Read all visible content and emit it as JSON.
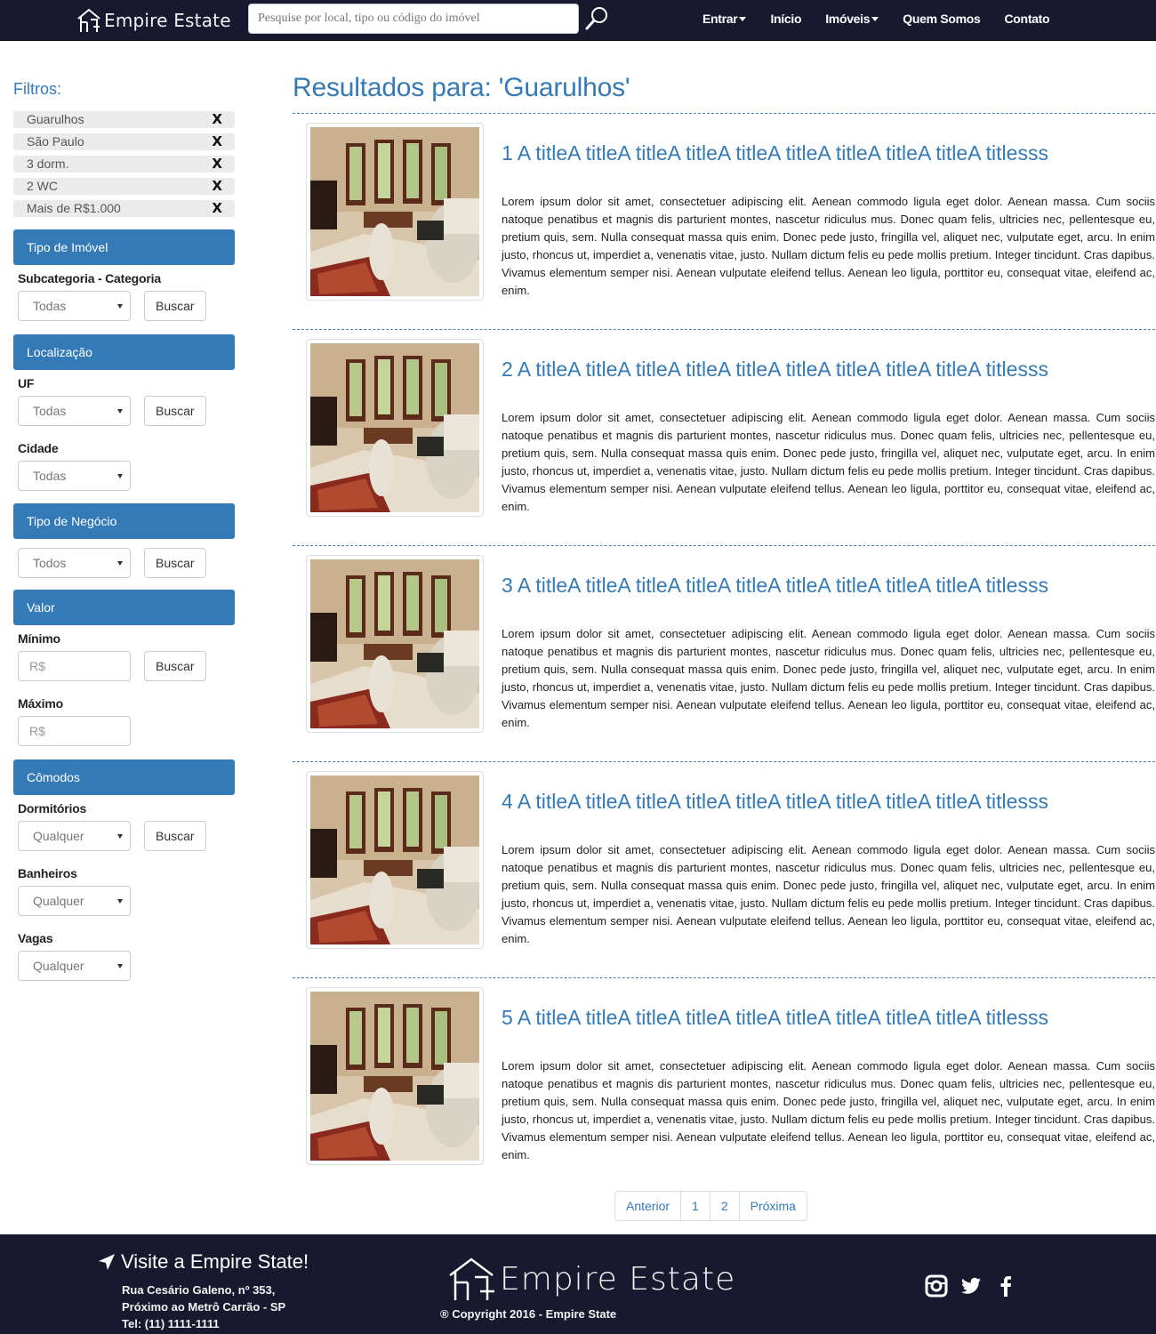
{
  "header": {
    "brand": "Empire Estate",
    "search_placeholder": "Pesquise por local, tipo ou código do imóvel",
    "nav": [
      "Entrar",
      "Início",
      "Imóveis",
      "Quem Somos",
      "Contato"
    ]
  },
  "sidebar": {
    "title": "Filtros:",
    "active_filters": [
      "Guarulhos",
      "São Paulo",
      "3 dorm.",
      "2 WC",
      "Mais de R$1.000"
    ],
    "remove_glyph": "X",
    "button_label": "Buscar",
    "sections": {
      "tipo_imovel": {
        "heading": "Tipo de Imóvel",
        "label": "Subcategoria - Categoria",
        "value": "Todas"
      },
      "localizacao": {
        "heading": "Localização",
        "uf_label": "UF",
        "uf_value": "Todas",
        "cidade_label": "Cidade",
        "cidade_value": "Todas"
      },
      "negocio": {
        "heading": "Tipo de Negócio",
        "value": "Todos"
      },
      "valor": {
        "heading": "Valor",
        "min_label": "Mínimo",
        "max_label": "Máximo",
        "placeholder": "R$"
      },
      "comodos": {
        "heading": "Cômodos",
        "dorm_label": "Dormitórios",
        "banh_label": "Banheiros",
        "vagas_label": "Vagas",
        "value": "Qualquer"
      }
    }
  },
  "main": {
    "results_title": "Resultados para: 'Guarulhos'",
    "listings": [
      {
        "title": "1 A titleA titleA titleA titleA titleA titleA titleA titleA titleA titlesss",
        "description": "Lorem ipsum dolor sit amet, consectetuer adipiscing elit. Aenean commodo ligula eget dolor. Aenean massa. Cum sociis natoque penatibus et magnis dis parturient montes, nascetur ridiculus mus. Donec quam felis, ultricies nec, pellentesque eu, pretium quis, sem. Nulla consequat massa quis enim. Donec pede justo, fringilla vel, aliquet nec, vulputate eget, arcu. In enim justo, rhoncus ut, imperdiet a, venenatis vitae, justo. Nullam dictum felis eu pede mollis pretium. Integer tincidunt. Cras dapibus. Vivamus elementum semper nisi. Aenean vulputate eleifend tellus. Aenean leo ligula, porttitor eu, consequat vitae, eleifend ac, enim."
      },
      {
        "title": "2 A titleA titleA titleA titleA titleA titleA titleA titleA titleA titlesss",
        "description": "Lorem ipsum dolor sit amet, consectetuer adipiscing elit. Aenean commodo ligula eget dolor. Aenean massa. Cum sociis natoque penatibus et magnis dis parturient montes, nascetur ridiculus mus. Donec quam felis, ultricies nec, pellentesque eu, pretium quis, sem. Nulla consequat massa quis enim. Donec pede justo, fringilla vel, aliquet nec, vulputate eget, arcu. In enim justo, rhoncus ut, imperdiet a, venenatis vitae, justo. Nullam dictum felis eu pede mollis pretium. Integer tincidunt. Cras dapibus. Vivamus elementum semper nisi. Aenean vulputate eleifend tellus. Aenean leo ligula, porttitor eu, consequat vitae, eleifend ac, enim."
      },
      {
        "title": "3 A titleA titleA titleA titleA titleA titleA titleA titleA titleA titlesss",
        "description": "Lorem ipsum dolor sit amet, consectetuer adipiscing elit. Aenean commodo ligula eget dolor. Aenean massa. Cum sociis natoque penatibus et magnis dis parturient montes, nascetur ridiculus mus. Donec quam felis, ultricies nec, pellentesque eu, pretium quis, sem. Nulla consequat massa quis enim. Donec pede justo, fringilla vel, aliquet nec, vulputate eget, arcu. In enim justo, rhoncus ut, imperdiet a, venenatis vitae, justo. Nullam dictum felis eu pede mollis pretium. Integer tincidunt. Cras dapibus. Vivamus elementum semper nisi. Aenean vulputate eleifend tellus. Aenean leo ligula, porttitor eu, consequat vitae, eleifend ac, enim."
      },
      {
        "title": "4 A titleA titleA titleA titleA titleA titleA titleA titleA titleA titlesss",
        "description": "Lorem ipsum dolor sit amet, consectetuer adipiscing elit. Aenean commodo ligula eget dolor. Aenean massa. Cum sociis natoque penatibus et magnis dis parturient montes, nascetur ridiculus mus. Donec quam felis, ultricies nec, pellentesque eu, pretium quis, sem. Nulla consequat massa quis enim. Donec pede justo, fringilla vel, aliquet nec, vulputate eget, arcu. In enim justo, rhoncus ut, imperdiet a, venenatis vitae, justo. Nullam dictum felis eu pede mollis pretium. Integer tincidunt. Cras dapibus. Vivamus elementum semper nisi. Aenean vulputate eleifend tellus. Aenean leo ligula, porttitor eu, consequat vitae, eleifend ac, enim."
      },
      {
        "title": "5 A titleA titleA titleA titleA titleA titleA titleA titleA titleA titlesss",
        "description": "Lorem ipsum dolor sit amet, consectetuer adipiscing elit. Aenean commodo ligula eget dolor. Aenean massa. Cum sociis natoque penatibus et magnis dis parturient montes, nascetur ridiculus mus. Donec quam felis, ultricies nec, pellentesque eu, pretium quis, sem. Nulla consequat massa quis enim. Donec pede justo, fringilla vel, aliquet nec, vulputate eget, arcu. In enim justo, rhoncus ut, imperdiet a, venenatis vitae, justo. Nullam dictum felis eu pede mollis pretium. Integer tincidunt. Cras dapibus. Vivamus elementum semper nisi. Aenean vulputate eleifend tellus. Aenean leo ligula, porttitor eu, consequat vitae, eleifend ac, enim."
      }
    ],
    "pagination": [
      "Anterior",
      "1",
      "2",
      "Próxima"
    ]
  },
  "footer": {
    "visit": "Visite a Empire State!",
    "address_line1": "Rua Cesário Galeno, nº 353,",
    "address_line2": "Próximo ao Metrô Carrão - SP",
    "phone": "Tel: (11) 1111-1111",
    "brand": "Empire Estate",
    "copyright": "® Copyright 2016 - Empire State",
    "socials": [
      "instagram-icon",
      "twitter-icon",
      "facebook-icon"
    ]
  },
  "colors": {
    "nav_bg": "#18192e",
    "accent": "#337ab7",
    "chip_bg": "#ebebeb"
  }
}
